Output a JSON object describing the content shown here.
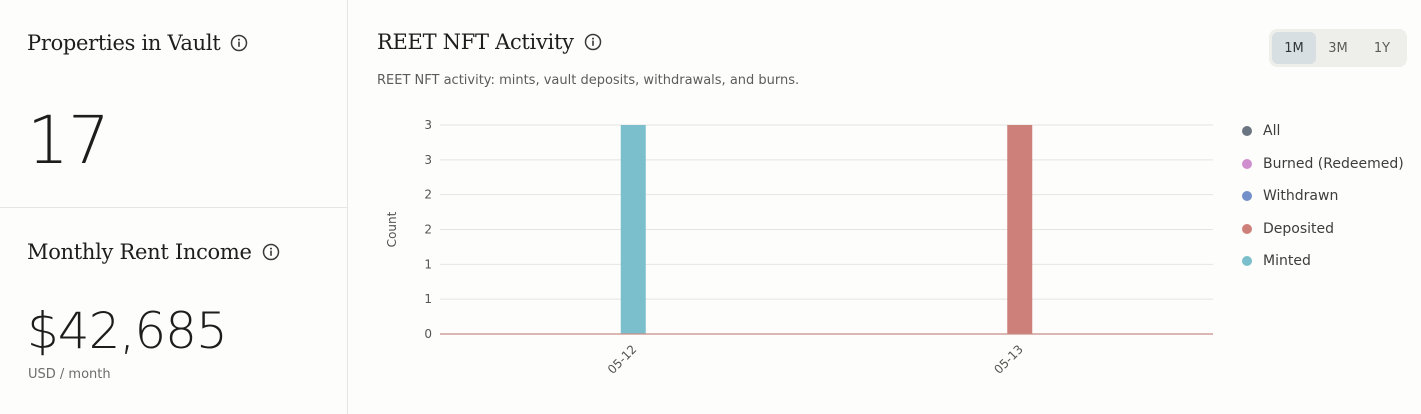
{
  "stats": {
    "properties": {
      "title": "Properties in Vault",
      "value": "17"
    },
    "rent": {
      "title": "Monthly Rent Income",
      "value": "$42,685",
      "caption": "USD / month"
    }
  },
  "chart_panel": {
    "title": "REET NFT Activity",
    "description": "REET NFT activity: mints, vault deposits, withdrawals, and burns.",
    "range_options": [
      "1M",
      "3M",
      "1Y"
    ],
    "selected_range": "1M"
  },
  "colors": {
    "all": "#6b7581",
    "burned": "#cf8fcf",
    "withdrawn": "#7490c8",
    "deposited": "#cd8079",
    "minted": "#7bbfcd"
  },
  "chart_data": {
    "type": "bar",
    "categories": [
      "05-12",
      "05-13"
    ],
    "series": [
      {
        "name": "All",
        "color": "#6b7581",
        "values": [
          0,
          0
        ]
      },
      {
        "name": "Burned (Redeemed)",
        "color": "#cf8fcf",
        "values": [
          0,
          0
        ]
      },
      {
        "name": "Withdrawn",
        "color": "#7490c8",
        "values": [
          0,
          0
        ]
      },
      {
        "name": "Deposited",
        "color": "#cd8079",
        "values": [
          0,
          3
        ]
      },
      {
        "name": "Minted",
        "color": "#7bbfcd",
        "values": [
          3,
          0
        ]
      }
    ],
    "ylabel": "Count",
    "xlabel": "",
    "ylim": [
      0,
      3
    ],
    "y_ticks": [
      0,
      0.5,
      1,
      1.5,
      2,
      2.5,
      3
    ],
    "y_tick_labels": [
      "0",
      "1",
      "1",
      "2",
      "2",
      "3",
      "3"
    ],
    "grid": true,
    "legend_position": "right"
  }
}
